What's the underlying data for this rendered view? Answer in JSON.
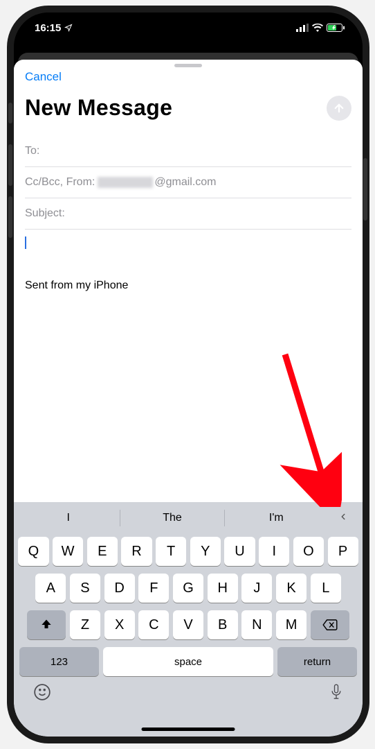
{
  "status_bar": {
    "time": "16:15"
  },
  "compose": {
    "cancel": "Cancel",
    "title": "New Message",
    "to_label": "To:",
    "ccbcc_label": "Cc/Bcc, From: ",
    "from_suffix": "@gmail.com",
    "subject_label": "Subject:",
    "body_signature": "Sent from my iPhone"
  },
  "keyboard": {
    "predictions": [
      "I",
      "The",
      "I'm"
    ],
    "row1": [
      "Q",
      "W",
      "E",
      "R",
      "T",
      "Y",
      "U",
      "I",
      "O",
      "P"
    ],
    "row2": [
      "A",
      "S",
      "D",
      "F",
      "G",
      "H",
      "J",
      "K",
      "L"
    ],
    "row3": [
      "Z",
      "X",
      "C",
      "V",
      "B",
      "N",
      "M"
    ],
    "numeric_key": "123",
    "space_key": "space",
    "return_key": "return"
  }
}
